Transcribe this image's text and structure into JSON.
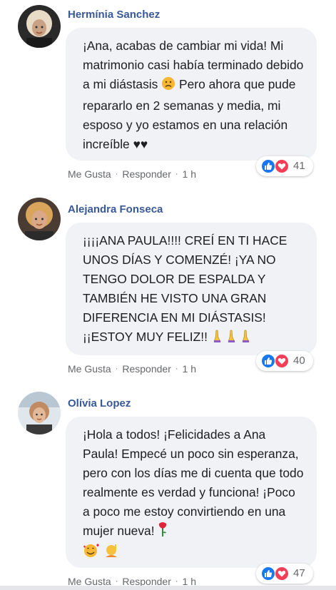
{
  "comments": [
    {
      "author": "Hermínia Sanchez",
      "text": "¡Ana, acabas de cambiar mi vida! Mi matrimonio casi había terminado debido a mi diástasis",
      "text_tail": " Pero ahora que pude repararlo en 2 semanas y media, mi esposo y yo estamos en una relación increíble ♥♥",
      "emoji": "sad-face-emoji",
      "like_label": "Me Gusta",
      "reply_label": "Responder",
      "time": "1 h",
      "reaction_count": "41"
    },
    {
      "author": "Alejandra Fonseca",
      "text": "¡¡¡¡ANA PAULA!!!! CREÍ EN TI HACE UNOS DÍAS Y COMENZÉ! ¡YA NO TENGO DOLOR DE ESPALDA Y TAMBIÉN HE VISTO UNA GRAN DIFERENCIA EN MI DIÁSTASIS! ¡¡ESTOY MUY FELIZ!!",
      "emoji": "praying-hands-emoji",
      "like_label": "Me Gusta",
      "reply_label": "Responder",
      "time": "1 h",
      "reaction_count": "40"
    },
    {
      "author": "Olívia Lopez",
      "text": "¡Hola a todos! ¡Felicidades a Ana Paula! Empecé un poco sin esperanza, pero con los días me di cuenta que todo realmente es verdad y funciona! ¡Poco a poco me estoy convirtiendo en una mujer nueva!",
      "emoji": "rose-emoji",
      "like_label": "Me Gusta",
      "reply_label": "Responder",
      "time": "1 h",
      "reaction_count": "47"
    }
  ],
  "dot_separator": "·",
  "colors": {
    "author": "#385898",
    "bubble": "#f0f2f5",
    "meta": "#65676b",
    "like": "#1877f2",
    "love": "#f33e58"
  }
}
